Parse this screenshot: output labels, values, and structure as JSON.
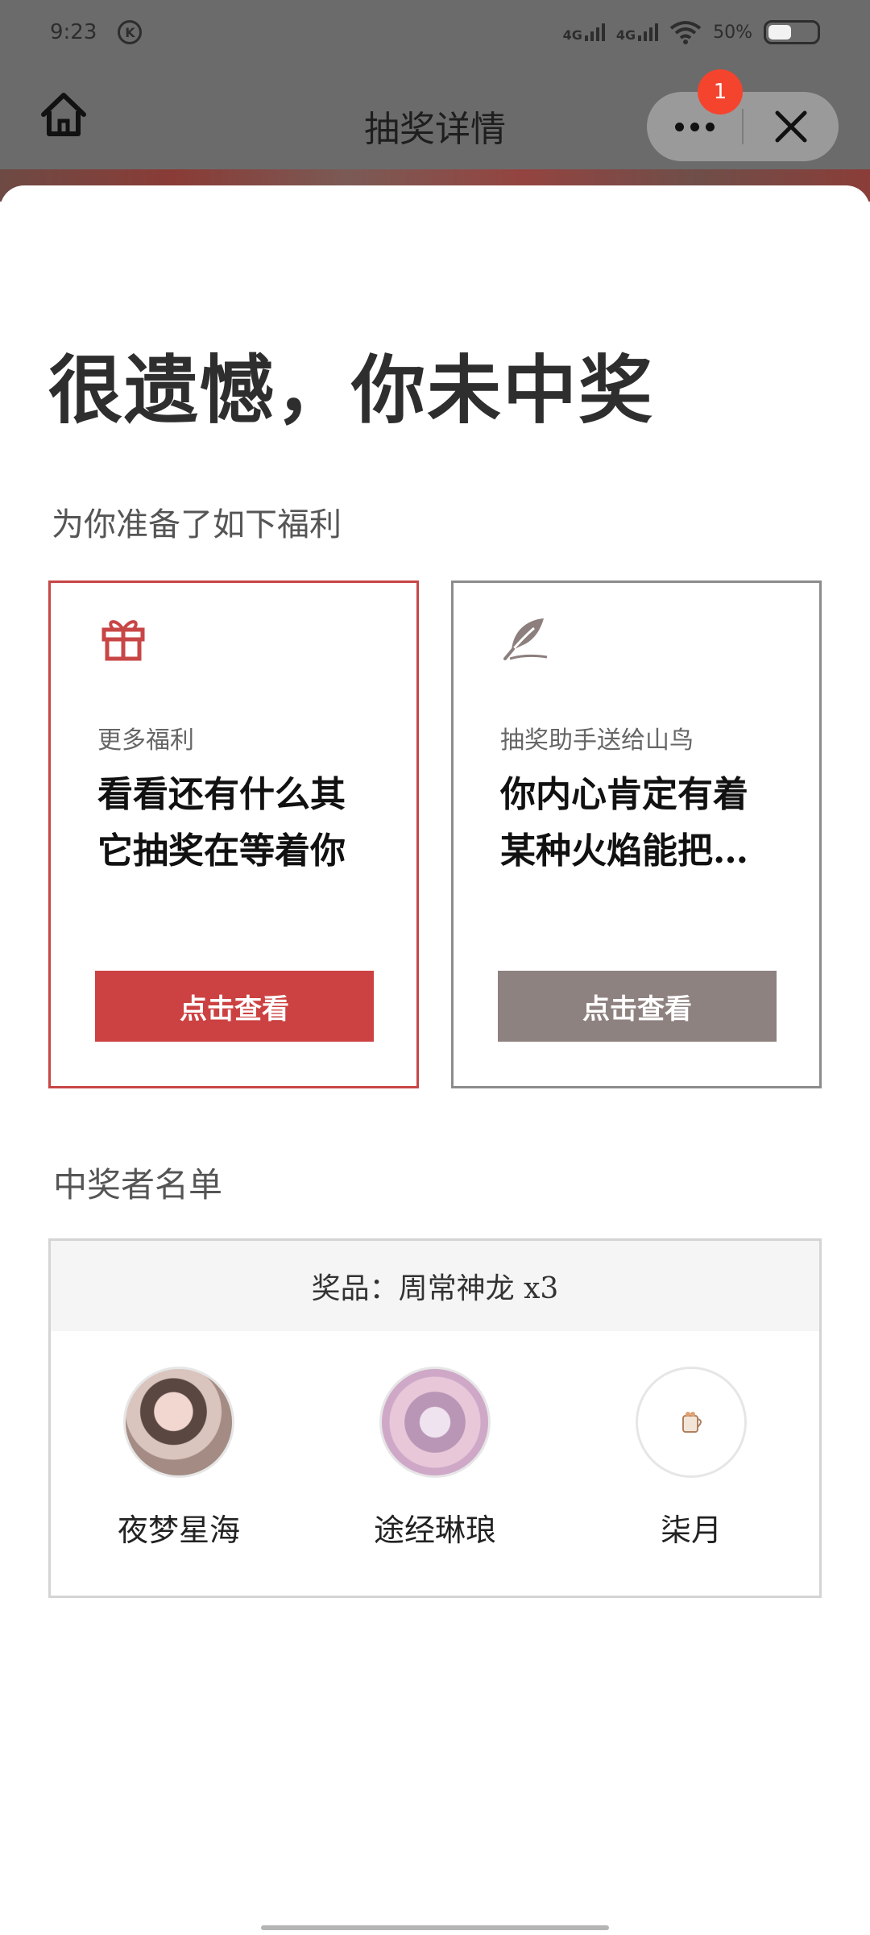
{
  "status_bar": {
    "time": "9:23",
    "badge": "K",
    "network_1": "4G",
    "network_2": "4G",
    "battery_percent": "50%"
  },
  "nav": {
    "title": "抽奖详情",
    "notification_count": "1"
  },
  "result": {
    "headline": "很遗憾，你未中奖",
    "benefits_title": "为你准备了如下福利"
  },
  "cards": [
    {
      "label": "更多福利",
      "body": "看看还有什么其它抽奖在等着你",
      "button": "点击查看",
      "icon": "gift-icon",
      "accent": "#cc4141"
    },
    {
      "label": "抽奖助手送给山鸟",
      "body": "你内心肯定有着某种火焰能把…",
      "button": "点击查看",
      "icon": "feather-icon",
      "accent": "#8e8280"
    }
  ],
  "winners": {
    "title": "中奖者名单",
    "prize": "奖品：周常神龙 x3",
    "list": [
      {
        "name": "夜梦星海"
      },
      {
        "name": "途经琳琅"
      },
      {
        "name": "柒月"
      }
    ]
  }
}
